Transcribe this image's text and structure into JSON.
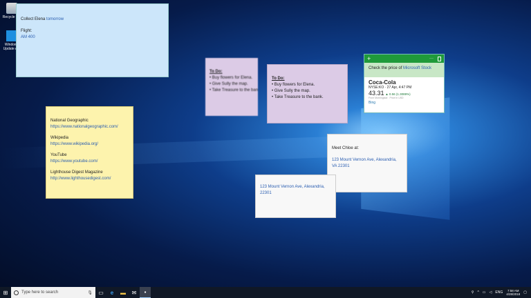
{
  "desktop": {
    "icons": [
      {
        "label": "Recycle Bin"
      },
      {
        "label": "Windows Update A..."
      }
    ]
  },
  "notes": {
    "blue": {
      "line1_prefix": "Collect Elena ",
      "line1_link": "tomorrow",
      "flight_label": "Flight:",
      "flight_value": "AM 400"
    },
    "todo_ghost": {
      "title": "To Do:",
      "items": [
        "• Buy flowers for Elena.",
        "• Give Sully the map.",
        "• Take Treasure to the bank."
      ]
    },
    "todo": {
      "title": "To Do:",
      "items": [
        "• Buy flowers for Elena.",
        "• Give Sully the map.",
        "• Take Treasure to the bank."
      ]
    },
    "stock": {
      "prompt_prefix": "Check the price of ",
      "prompt_link": "Microsoft Stock",
      "name": "Coca-Cola",
      "exchange": "NYSE:KO · 27 Apr, 4:47 PM",
      "price": "43.31",
      "change": "▲ 0.56 (1.3089%)",
      "source": "From Morningstar",
      "currency": "Price in USD",
      "bing": "Bing",
      "more": "···",
      "add": "+"
    },
    "yellow": {
      "items": [
        {
          "title": "National Geographic",
          "url": "https://www.nationalgeographic.com/"
        },
        {
          "title": "Wikipedia",
          "url": "https://www.wikipedia.org/"
        },
        {
          "title": "YouTube",
          "url": "https://www.youtube.com/"
        },
        {
          "title": "Lighthouse Digest Magazine",
          "url": "http://www.lighthousedigest.com/"
        }
      ]
    },
    "meet": {
      "text": "Meet Chloe at:",
      "address": "123 Mount Vernon Ave, Alexandria, VA 22301"
    },
    "address": {
      "line1": "123 Mount Vernon Ave, Alexandria,",
      "line2": "22301"
    }
  },
  "taskbar": {
    "search_placeholder": "Type here to search",
    "lang": "ENG",
    "time": "7:58 AM",
    "date": "4/28/2018"
  },
  "colors": {
    "stock_green": "#1f9a3a",
    "blue_note": "#cce6fa",
    "yellow_note": "#fdf3ad",
    "purple_note": "#dccbe6"
  }
}
